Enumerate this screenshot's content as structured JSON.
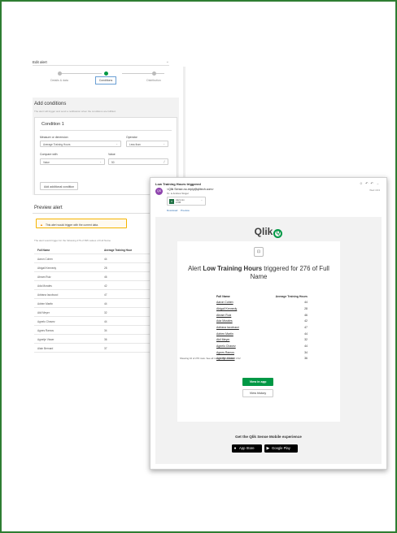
{
  "editor": {
    "title": "Edit alert",
    "dropdown_glyph": "⌄",
    "steps": [
      {
        "label": "Details & data",
        "state": "done"
      },
      {
        "label": "Conditions",
        "state": "active"
      },
      {
        "label": "Distribution",
        "state": "todo"
      }
    ],
    "add_conditions": {
      "heading": "Add conditions",
      "subtitle": "The alert will trigger and send a notification when the conditions are fulfilled.",
      "condition_title": "Condition 1",
      "measure_label": "Measure or dimension",
      "measure_value": "Average Training Hours",
      "operator_label": "Operator",
      "operator_value": "Less than",
      "compare_label": "Compare with",
      "compare_value": "Value",
      "value_label": "Value",
      "value_value": "50",
      "add_button": "Add additional condition"
    },
    "preview": {
      "heading": "Preview alert",
      "warning": "This alert would trigger with the current data.",
      "trigger_note": "The alert would trigger for the following 276 of 835 values of Full Name",
      "col_name": "Full Name",
      "col_value": "Average Training Hour",
      "rows": [
        {
          "name": "Aaron Cohen",
          "value": "44"
        },
        {
          "name": "Abigail Kennedy",
          "value": "28"
        },
        {
          "name": "Abram Ruiz",
          "value": "46"
        },
        {
          "name": "Ada Morales",
          "value": "42"
        },
        {
          "name": "Adriana Iacobucci",
          "value": "47"
        },
        {
          "name": "Adrien Martin",
          "value": "44"
        },
        {
          "name": "Akil Meyer",
          "value": "32"
        },
        {
          "name": "Agnelo Chavez",
          "value": "44"
        },
        {
          "name": "Agnes Ramos",
          "value": "34"
        },
        {
          "name": "Agnetje Visser",
          "value": "36"
        },
        {
          "name": "Alain Bernard",
          "value": "37"
        }
      ],
      "pager": "‹ 1 ›"
    }
  },
  "email": {
    "subject": "Low Training Hours triggered",
    "toolbar_icons": "☺ ↶ ↶ →",
    "date": "Wed 4/13",
    "avatar_initials": "QS",
    "from": "<Qlik Sense-no-reply@qlitech.com>",
    "to": "To: ● Andrew Singer",
    "attachment_name": "Alert.csv",
    "attachment_size": "2 KB",
    "attachment_chevron": "⌄",
    "links": "Download Preview",
    "logo_text": "Qlik",
    "logo_q": "Q",
    "card_icon": "⊡",
    "title_pre": "Alert ",
    "title_bold": "Low Training Hours",
    "title_post": " triggered for 276 of Full Name",
    "col_name": "Full Name",
    "col_value": "Average Training Hours",
    "rows": [
      {
        "name": "Aaron Cohen",
        "value": "44"
      },
      {
        "name": "Abigail Kennedy",
        "value": "28"
      },
      {
        "name": "Abram Ruiz",
        "value": "46"
      },
      {
        "name": "Ada Morales",
        "value": "42"
      },
      {
        "name": "Adriana Iacobucci",
        "value": "47"
      },
      {
        "name": "Adrien Martin",
        "value": "44"
      },
      {
        "name": "Akil Meyer",
        "value": "32"
      },
      {
        "name": "Agnelo Chavez",
        "value": "44"
      },
      {
        "name": "Agnes Ramos",
        "value": "34"
      },
      {
        "name": "Agnetje Visser",
        "value": "36"
      }
    ],
    "showing": "Showing 10 of 276 rows. See all rows in the attached CSV.",
    "view_in_app": "View in app",
    "view_history": "View history",
    "mobile_title": "Get the Qlik Sense Mobile experience",
    "app_store": "App Store",
    "google_play": "Google Play"
  },
  "colors": {
    "frame_border": "#2e7d32",
    "qlik_green": "#009845",
    "warning_border": "#f5b400"
  }
}
